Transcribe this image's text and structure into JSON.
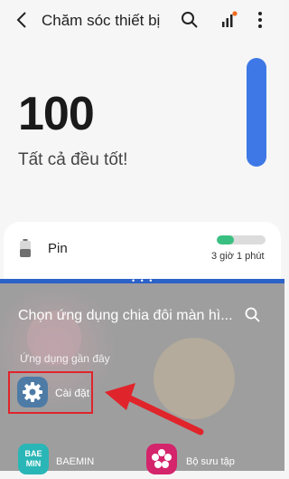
{
  "header": {
    "title": "Chăm sóc thiết bị"
  },
  "summary": {
    "score": "100",
    "status": "Tất cả đều tốt!",
    "meter_level_pct": 100
  },
  "battery": {
    "label": "Pin",
    "time_remaining": "3 giờ 1 phút",
    "level_pct": 35
  },
  "picker": {
    "title": "Chọn ứng dụng chia đôi màn hì...",
    "recent_label": "Ứng dụng gần đây",
    "apps": [
      {
        "label": "Cài đặt",
        "icon": "gear-icon"
      },
      {
        "label": "BAEMIN",
        "icon_text": "BAE\nMIN"
      },
      {
        "label": "Bộ sưu tập",
        "icon": "flower-icon"
      }
    ]
  },
  "colors": {
    "accent": "#2d62c8",
    "meter": "#3d78e6",
    "battery_fill": "#39c081",
    "highlight": "#e0242b"
  }
}
